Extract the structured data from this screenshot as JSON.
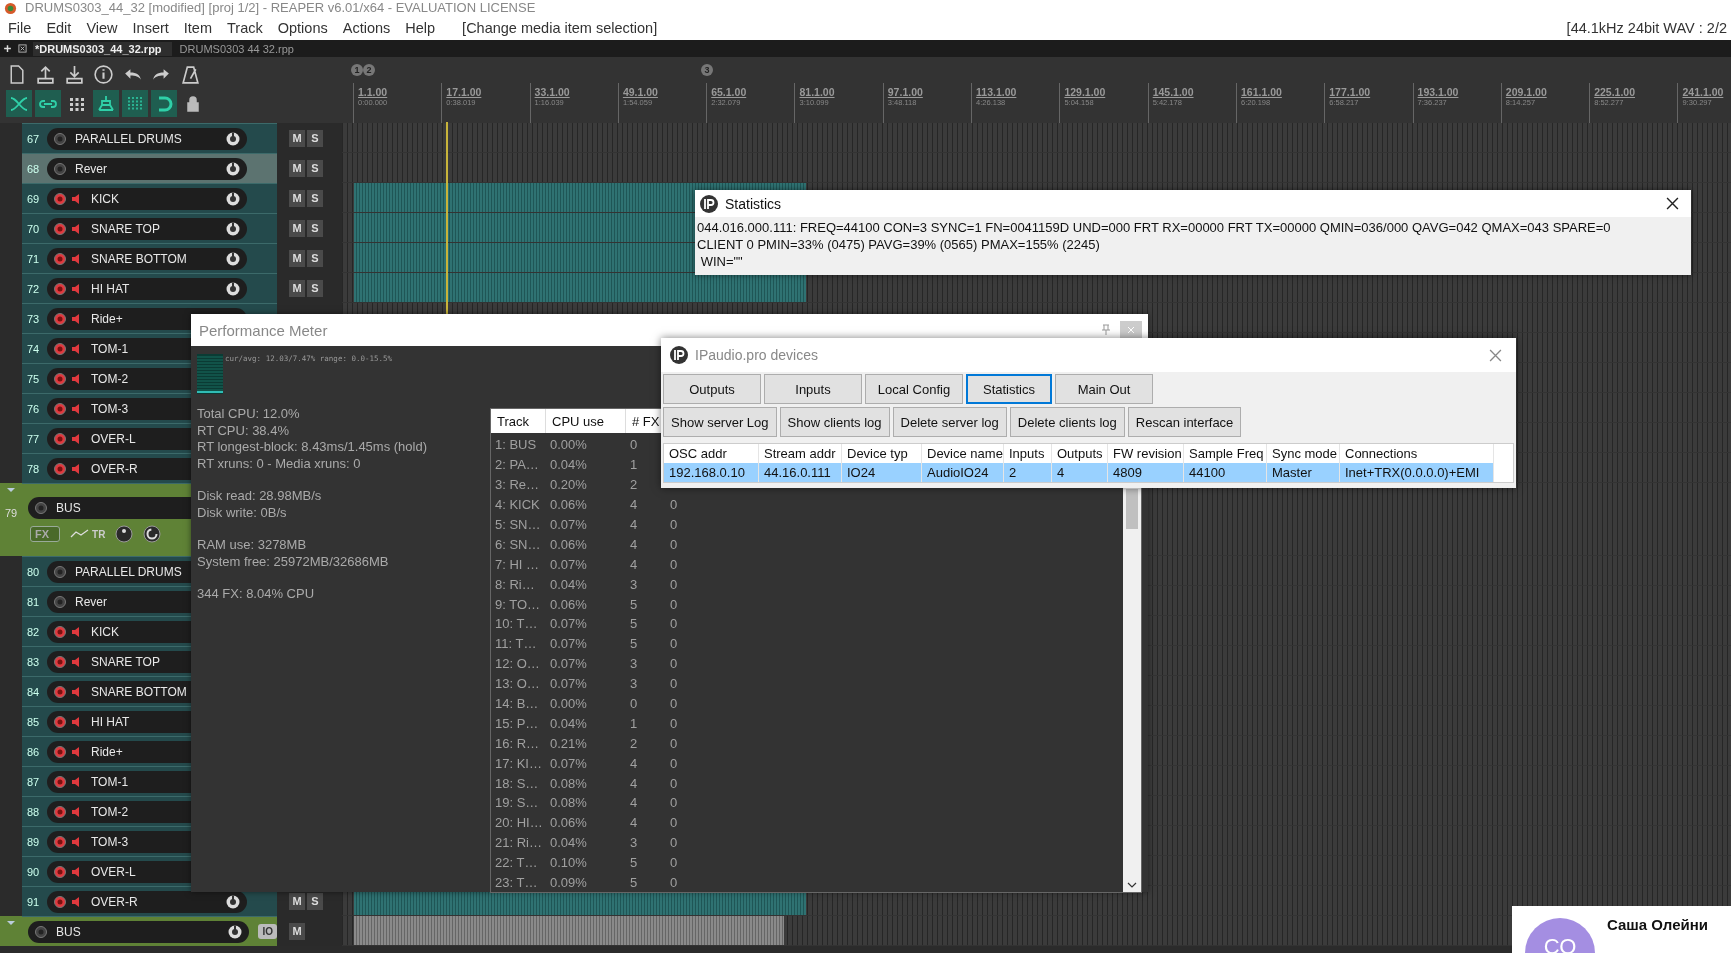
{
  "window": {
    "title": "DRUMS0303_44_32 [modified] [proj 1/2] - REAPER v6.01/x64 - EVALUATION LICENSE"
  },
  "menu": {
    "items": [
      "File",
      "Edit",
      "View",
      "Insert",
      "Item",
      "Track",
      "Options",
      "Actions",
      "Help"
    ],
    "status": "[Change media item selection]",
    "format": "[44.1kHz 24bit WAV : 2/2"
  },
  "project_tabs": [
    {
      "label": "*DRUMS0303_44_32.rpp",
      "selected": true
    },
    {
      "label": "DRUMS0303  44  32.rpp",
      "selected": false
    }
  ],
  "toolbar_toggles": [
    {
      "kind": "crossfade",
      "on": true
    },
    {
      "kind": "link",
      "on": true
    },
    {
      "kind": "grid",
      "on": false
    },
    {
      "kind": "ripple",
      "on": true
    },
    {
      "kind": "lines",
      "on": true
    },
    {
      "kind": "snap",
      "on": true
    },
    {
      "kind": "lock",
      "on": false
    }
  ],
  "ruler": {
    "markers": [
      {
        "label": "1"
      },
      {
        "label": "2"
      },
      {
        "label": "3"
      }
    ],
    "ticks": [
      {
        "bar": "1.1.00",
        "time": "0:00.000"
      },
      {
        "bar": "17.1.00",
        "time": "0:38.019"
      },
      {
        "bar": "33.1.00",
        "time": "1:16.039"
      },
      {
        "bar": "49.1.00",
        "time": "1:54.059"
      },
      {
        "bar": "65.1.00",
        "time": "2:32.079"
      },
      {
        "bar": "81.1.00",
        "time": "3:10.099"
      },
      {
        "bar": "97.1.00",
        "time": "3:48.118"
      },
      {
        "bar": "113.1.00",
        "time": "4:26.138"
      },
      {
        "bar": "129.1.00",
        "time": "5:04.158"
      },
      {
        "bar": "145.1.00",
        "time": "5:42.178"
      },
      {
        "bar": "161.1.00",
        "time": "6:20.198"
      },
      {
        "bar": "177.1.00",
        "time": "6:58.217"
      },
      {
        "bar": "193.1.00",
        "time": "7:36.237"
      },
      {
        "bar": "209.1.00",
        "time": "8:14.257"
      },
      {
        "bar": "225.1.00",
        "time": "8:52.277"
      },
      {
        "bar": "241.1.00",
        "time": "9:30.297"
      }
    ]
  },
  "tracks": [
    {
      "number": "67",
      "name": "PARALLEL DRUMS",
      "kind": "track",
      "armed": false,
      "selected": false,
      "pan_knob": true,
      "buttons": [
        "M",
        "S"
      ],
      "media_item": false
    },
    {
      "number": "68",
      "name": "Rever",
      "kind": "track",
      "armed": false,
      "selected": true,
      "pan_knob": true,
      "buttons": [
        "M",
        "S"
      ],
      "media_item": false
    },
    {
      "number": "69",
      "name": "KICK",
      "kind": "track",
      "armed": true,
      "selected": false,
      "pan_knob": true,
      "buttons": [
        "M",
        "S"
      ],
      "media_item": true
    },
    {
      "number": "70",
      "name": "SNARE TOP",
      "kind": "track",
      "armed": true,
      "selected": false,
      "pan_knob": true,
      "buttons": [
        "M",
        "S"
      ],
      "media_item": true
    },
    {
      "number": "71",
      "name": "SNARE BOTTOM",
      "kind": "track",
      "armed": true,
      "selected": false,
      "pan_knob": true,
      "buttons": [
        "M",
        "S"
      ],
      "media_item": true
    },
    {
      "number": "72",
      "name": "HI HAT",
      "kind": "track",
      "armed": true,
      "selected": false,
      "pan_knob": true,
      "buttons": [
        "M",
        "S"
      ],
      "media_item": true
    },
    {
      "number": "73",
      "name": "Ride+",
      "kind": "track",
      "armed": true,
      "selected": false
    },
    {
      "number": "74",
      "name": "TOM-1",
      "kind": "track",
      "armed": true,
      "selected": false
    },
    {
      "number": "75",
      "name": "TOM-2",
      "kind": "track",
      "armed": true,
      "selected": false
    },
    {
      "number": "76",
      "name": "TOM-3",
      "kind": "track",
      "armed": true,
      "selected": false
    },
    {
      "number": "77",
      "name": "OVER-L",
      "kind": "track",
      "armed": true,
      "selected": false
    },
    {
      "number": "78",
      "name": "OVER-R",
      "kind": "track",
      "armed": true,
      "selected": false
    },
    {
      "number": "79",
      "name": "BUS",
      "kind": "folder",
      "armed": false,
      "selected": false,
      "chips": [
        {
          "kind": "fx",
          "label": "FX"
        },
        {
          "kind": "tr",
          "label": "TR"
        }
      ]
    },
    {
      "number": "80",
      "name": "PARALLEL DRUMS",
      "kind": "track",
      "armed": false,
      "selected": false
    },
    {
      "number": "81",
      "name": "Rever",
      "kind": "track",
      "armed": false,
      "selected": false
    },
    {
      "number": "82",
      "name": "KICK",
      "kind": "track",
      "armed": true,
      "selected": false
    },
    {
      "number": "83",
      "name": "SNARE TOP",
      "kind": "track",
      "armed": true,
      "selected": false
    },
    {
      "number": "84",
      "name": "SNARE BOTTOM",
      "kind": "track",
      "armed": true,
      "selected": false
    },
    {
      "number": "85",
      "name": "HI HAT",
      "kind": "track",
      "armed": true,
      "selected": false
    },
    {
      "number": "86",
      "name": "Ride+",
      "kind": "track",
      "armed": true,
      "selected": false
    },
    {
      "number": "87",
      "name": "TOM-1",
      "kind": "track",
      "armed": true,
      "selected": false
    },
    {
      "number": "88",
      "name": "TOM-2",
      "kind": "track",
      "armed": true,
      "selected": false
    },
    {
      "number": "89",
      "name": "TOM-3",
      "kind": "track",
      "armed": true,
      "selected": false
    },
    {
      "number": "90",
      "name": "OVER-L",
      "kind": "track",
      "armed": true,
      "selected": false
    },
    {
      "number": "91",
      "name": "OVER-R",
      "kind": "track",
      "armed": true,
      "selected": false,
      "pan_knob": true,
      "buttons": [
        "M",
        "S"
      ],
      "media_item": true
    },
    {
      "name": "BUS",
      "kind": "folder",
      "armed": false,
      "selected": false,
      "pan_knob": true,
      "chips": [
        {
          "kind": "io",
          "label": "IO"
        }
      ],
      "buttons": [
        "M"
      ],
      "media_item": true
    }
  ],
  "performance_meter": {
    "title": "Performance Meter",
    "graph_caption": "cur/avg: 12.03/7.47%  range: 0.0-15.5%",
    "stats": [
      [
        "Total CPU: 12.0%",
        "RT CPU: 38.4%",
        "RT longest-block: 8.43ms/1.45ms (hold)",
        "RT xruns: 0 - Media xruns: 0"
      ],
      [
        "Disk read: 28.98MB/s",
        "Disk write: 0B/s"
      ],
      [
        "RAM use: 3278MB",
        "System free: 25972MB/32686MB"
      ],
      [
        "344 FX: 8.04% CPU"
      ]
    ],
    "columns": [
      "Track",
      "CPU use",
      "# FX"
    ],
    "rows": [
      {
        "track": "1: BUS",
        "cpu": "0.00%",
        "fx": "0"
      },
      {
        "track": "2: PA…",
        "cpu": "0.04%",
        "fx": "1"
      },
      {
        "track": "3: Re…",
        "cpu": "0.20%",
        "fx": "2"
      },
      {
        "track": "4: KICK",
        "cpu": "0.06%",
        "fx": "4",
        "column_4": "0"
      },
      {
        "track": "5: SN…",
        "cpu": "0.07%",
        "fx": "4",
        "column_4": "0"
      },
      {
        "track": "6: SN…",
        "cpu": "0.06%",
        "fx": "4",
        "column_4": "0"
      },
      {
        "track": "7: HI …",
        "cpu": "0.07%",
        "fx": "4",
        "column_4": "0"
      },
      {
        "track": "8: Ri…",
        "cpu": "0.04%",
        "fx": "3",
        "column_4": "0"
      },
      {
        "track": "9: TO…",
        "cpu": "0.06%",
        "fx": "5",
        "column_4": "0"
      },
      {
        "track": "10: T…",
        "cpu": "0.07%",
        "fx": "5",
        "column_4": "0"
      },
      {
        "track": "11: T…",
        "cpu": "0.07%",
        "fx": "5",
        "column_4": "0"
      },
      {
        "track": "12: O…",
        "cpu": "0.07%",
        "fx": "3",
        "column_4": "0"
      },
      {
        "track": "13: O…",
        "cpu": "0.07%",
        "fx": "3",
        "column_4": "0"
      },
      {
        "track": "14: B…",
        "cpu": "0.00%",
        "fx": "0",
        "column_4": "0"
      },
      {
        "track": "15: P…",
        "cpu": "0.04%",
        "fx": "1",
        "column_4": "0"
      },
      {
        "track": "16: R…",
        "cpu": "0.21%",
        "fx": "2",
        "column_4": "0"
      },
      {
        "track": "17: KI…",
        "cpu": "0.07%",
        "fx": "4",
        "column_4": "0"
      },
      {
        "track": "18: S…",
        "cpu": "0.08%",
        "fx": "4",
        "column_4": "0"
      },
      {
        "track": "19: S…",
        "cpu": "0.08%",
        "fx": "4",
        "column_4": "0"
      },
      {
        "track": "20: HI…",
        "cpu": "0.06%",
        "fx": "4",
        "column_4": "0"
      },
      {
        "track": "21: Ri…",
        "cpu": "0.04%",
        "fx": "3",
        "column_4": "0"
      },
      {
        "track": "22: T…",
        "cpu": "0.10%",
        "fx": "5",
        "column_4": "0"
      },
      {
        "track": "23: T…",
        "cpu": "0.09%",
        "fx": "5",
        "column_4": "0"
      }
    ]
  },
  "statistics_window": {
    "title": "Statistics",
    "lines": [
      "044.016.000.111: FREQ=44100 CON=3 SYNC=1 FN=0041159D UND=000 FRT RX=00000 FRT TX=00000 QMIN=036/000 QAVG=042 QMAX=043 SPARE=0",
      "CLIENT 0 PMIN=33% (0475) PAVG=39% (0565) PMAX=155% (2245)",
      " WIN=\"\""
    ]
  },
  "devices_window": {
    "title": "IPaudio.pro devices",
    "tabs": [
      {
        "label": "Outputs",
        "selected": false
      },
      {
        "label": "Inputs",
        "selected": false
      },
      {
        "label": "Local Config",
        "selected": false
      },
      {
        "label": "Statistics",
        "selected": true
      },
      {
        "label": "Main Out",
        "selected": false
      }
    ],
    "buttons": [
      "Show server Log",
      "Show clients log",
      "Delete server log",
      "Delete clients log",
      "Rescan interface"
    ],
    "columns": [
      "OSC addr",
      "Stream addr",
      "Device typ",
      "Device name",
      "Inputs",
      "Outputs",
      "FW revision",
      "Sample Freq",
      "Sync mode",
      "Connections"
    ],
    "rows": [
      {
        "selected": true,
        "cells": [
          "192.168.0.10",
          "44.16.0.111",
          "IO24",
          "AudioIO24",
          "2",
          "4",
          "4809",
          "44100",
          "Master",
          "Inet+TRX(0.0.0.0)+EMI"
        ]
      }
    ]
  },
  "notification": {
    "avatar": "СО",
    "name": "Саша Олейни"
  }
}
